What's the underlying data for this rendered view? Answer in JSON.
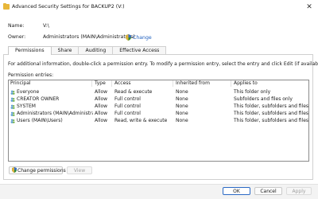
{
  "window": {
    "title": "Advanced Security Settings for BACKUP2 (V:)",
    "close_glyph": "✕"
  },
  "fields": {
    "name_label": "Name:",
    "name_value": "V:\\",
    "owner_label": "Owner:",
    "owner_value": "Administrators (MAIN\\Administrators)",
    "change_link": "Change"
  },
  "tabs": [
    {
      "label": "Permissions",
      "active": true
    },
    {
      "label": "Share",
      "active": false
    },
    {
      "label": "Auditing",
      "active": false
    },
    {
      "label": "Effective Access",
      "active": false
    }
  ],
  "permissions": {
    "info": "For additional information, double-click a permission entry. To modify a permission entry, select the entry and click Edit (if available).",
    "entries_label": "Permission entries:",
    "columns": [
      "Principal",
      "Type",
      "Access",
      "Inherited from",
      "Applies to"
    ],
    "rows": [
      {
        "principal": "Everyone",
        "type": "Allow",
        "access": "Read & execute",
        "inherited": "None",
        "applies": "This folder only"
      },
      {
        "principal": "CREATOR OWNER",
        "type": "Allow",
        "access": "Full control",
        "inherited": "None",
        "applies": "Subfolders and files only"
      },
      {
        "principal": "SYSTEM",
        "type": "Allow",
        "access": "Full control",
        "inherited": "None",
        "applies": "This folder, subfolders and files"
      },
      {
        "principal": "Administrators (MAIN\\Administrat...",
        "type": "Allow",
        "access": "Full control",
        "inherited": "None",
        "applies": "This folder, subfolders and files"
      },
      {
        "principal": "Users (MAIN\\Users)",
        "type": "Allow",
        "access": "Read, write & execute",
        "inherited": "None",
        "applies": "This folder, subfolders and files"
      }
    ]
  },
  "buttons": {
    "change_permissions": "Change permissions",
    "view": "View",
    "ok": "OK",
    "cancel": "Cancel",
    "apply": "Apply"
  },
  "colors": {
    "link": "#1f5fbf",
    "accent": "#2b6ac5",
    "folder": "#e8b73a"
  },
  "icons": {
    "title": "folder-drive-icon",
    "change": "shield-icon",
    "principal": "user-group-icon"
  }
}
